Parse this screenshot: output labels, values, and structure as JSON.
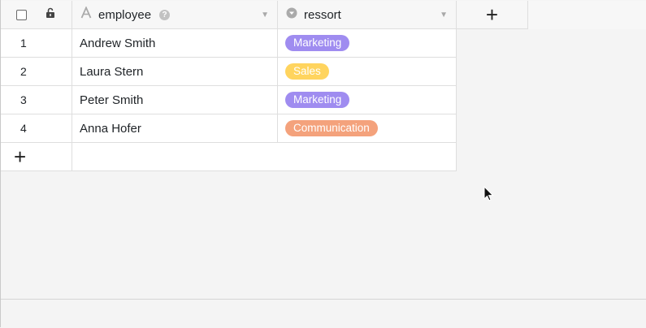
{
  "header": {
    "columns": [
      {
        "name": "employee",
        "icon": "text-type-icon"
      },
      {
        "name": "ressort",
        "icon": "single-select-icon"
      }
    ],
    "add_column_label": "+"
  },
  "rows": [
    {
      "index": "1",
      "employee": "Andrew Smith",
      "ressort": "Marketing",
      "ressort_color": "#9f8cf0"
    },
    {
      "index": "2",
      "employee": "Laura Stern",
      "ressort": "Sales",
      "ressort_color": "#ffd45e"
    },
    {
      "index": "3",
      "employee": "Peter Smith",
      "ressort": "Marketing",
      "ressort_color": "#9f8cf0"
    },
    {
      "index": "4",
      "employee": "Anna Hofer",
      "ressort": "Communication",
      "ressort_color": "#f4a27c"
    }
  ],
  "add_row_label": "+",
  "icons": [
    "checkbox-icon",
    "unlock-icon",
    "text-type-icon",
    "help-icon",
    "chevron-down-icon",
    "single-select-icon",
    "plus-icon",
    "mouse-cursor-icon"
  ]
}
